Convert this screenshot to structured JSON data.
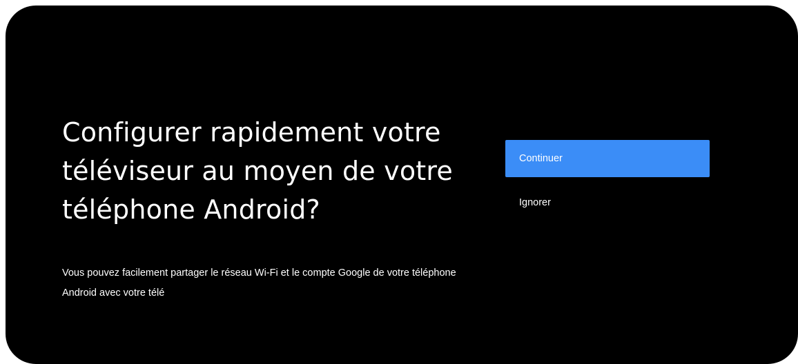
{
  "setup": {
    "title": "Configurer rapidement votre téléviseur au moyen de votre téléphone Android?",
    "description": "Vous pouvez facilement partager le réseau Wi-Fi et le compte Google de votre téléphone Android avec votre télé",
    "continue_label": "Continuer",
    "ignore_label": "Ignorer"
  },
  "colors": {
    "background": "#000000",
    "accent": "#3b8df7",
    "text": "#ffffff"
  }
}
